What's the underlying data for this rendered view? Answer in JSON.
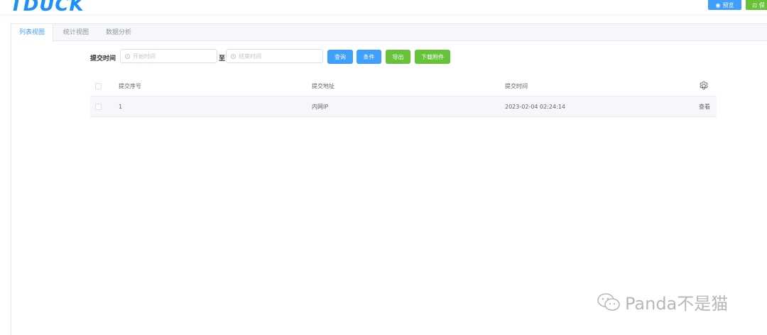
{
  "header": {
    "logo": "TDUCK",
    "preview_label": "预览",
    "save_label": "保"
  },
  "tabs": [
    {
      "label": "列表视图",
      "active": true
    },
    {
      "label": "统计视图",
      "active": false
    },
    {
      "label": "数据分析",
      "active": false
    }
  ],
  "filter": {
    "label": "提交时间",
    "start_placeholder": "开始时间",
    "separator": "至",
    "end_placeholder": "结束时间",
    "buttons": {
      "query": "查询",
      "condition": "条件",
      "export": "导出",
      "download": "下载附件"
    }
  },
  "table": {
    "columns": [
      "提交序号",
      "提交地址",
      "提交时间"
    ],
    "rows": [
      {
        "index": "1",
        "address": "内网IP",
        "time": "2023-02-04 02:24:14",
        "action": "查看"
      }
    ]
  },
  "watermark": {
    "text": "Panda不是猫"
  }
}
